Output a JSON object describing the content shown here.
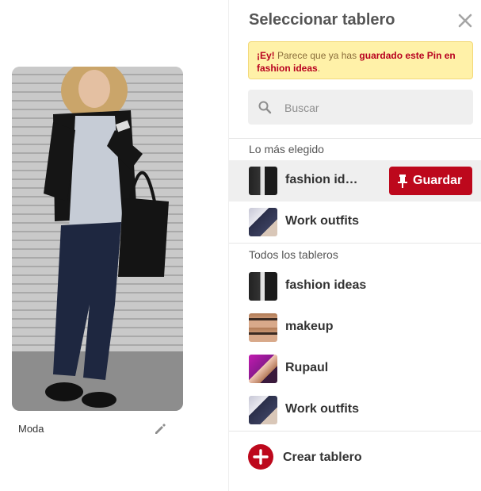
{
  "pin": {
    "caption": "Moda"
  },
  "dialog": {
    "title": "Seleccionar tablero",
    "notice": {
      "prefix_bold": "¡Ey!",
      "text": " Parece que ya has ",
      "link_text": "guardado este Pin en fashion ideas",
      "suffix": "."
    },
    "search": {
      "placeholder": "Buscar"
    },
    "top_section_label": "Lo más elegido",
    "top_boards": [
      {
        "label": "fashion id…",
        "thumb": "fashion"
      },
      {
        "label": "Work outfits",
        "thumb": "work"
      }
    ],
    "save_label": "Guardar",
    "all_section_label": "Todos los tableros",
    "all_boards": [
      {
        "label": "fashion ideas",
        "thumb": "fashion"
      },
      {
        "label": "makeup",
        "thumb": "makeup"
      },
      {
        "label": "Rupaul",
        "thumb": "rupaul"
      },
      {
        "label": "Work outfits",
        "thumb": "work"
      }
    ],
    "create_label": "Crear tablero"
  },
  "colors": {
    "accent": "#bd081c",
    "notice_bg": "#fff1a8"
  },
  "icons": {
    "close": "close-icon",
    "search": "search-icon",
    "edit": "pencil-icon",
    "save": "pushpin-icon",
    "create": "plus-icon"
  }
}
